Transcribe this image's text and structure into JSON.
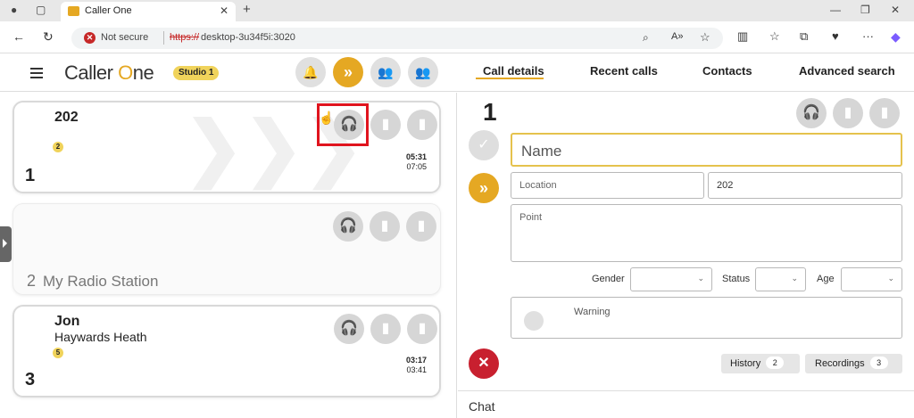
{
  "browser": {
    "tab_title": "Caller One",
    "security_label": "Not secure",
    "url_protocol": "https://",
    "url_host": "desktop-3u34f5i:3020"
  },
  "app": {
    "logo_prefix": "Caller ",
    "logo_o": "O",
    "logo_suffix": "ne",
    "studio_label": "Studio 1",
    "header_buttons": [
      "bell-icon",
      "forward-icon",
      "operator-1-icon",
      "operator-2-icon"
    ],
    "nav_tabs": [
      "Call details",
      "Recent calls",
      "Contacts",
      "Advanced search"
    ],
    "active_tab": "Call details",
    "accent_color": "#e5a823"
  },
  "lines": [
    {
      "line": "1",
      "name": "202",
      "location": "",
      "badge": "2",
      "duration": "05:31",
      "time": "07:05",
      "state": "active"
    },
    {
      "line": "2",
      "station": "My Radio Station",
      "state": "empty"
    },
    {
      "line": "3",
      "name": "Jon",
      "location": "Haywards Heath",
      "badge": "5",
      "duration": "03:17",
      "time": "03:41",
      "state": "active"
    }
  ],
  "details": {
    "line_number": "1",
    "name_placeholder": "Name",
    "location_placeholder": "Location",
    "phone_value": "202",
    "point_placeholder": "Point",
    "gender_label": "Gender",
    "status_label": "Status",
    "age_label": "Age",
    "warning_label": "Warning",
    "history_label": "History",
    "history_count": "2",
    "recordings_label": "Recordings",
    "recordings_count": "3",
    "chat_label": "Chat"
  }
}
